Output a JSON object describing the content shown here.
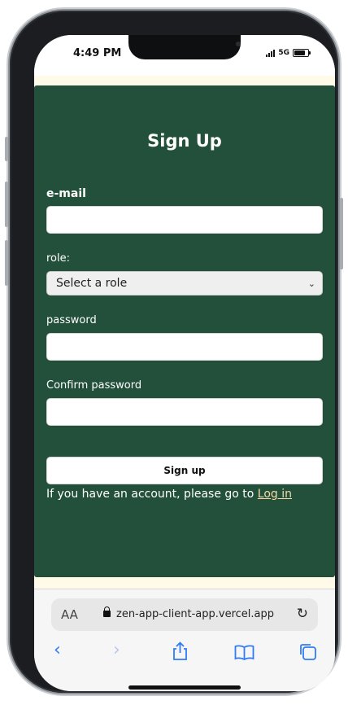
{
  "status_bar": {
    "time": "4:49 PM",
    "network": "5G"
  },
  "form": {
    "title": "Sign Up",
    "email_label": "e-mail",
    "email_value": "",
    "role_label": "role:",
    "role_selected": "Select a role",
    "password_label": "password",
    "confirm_label": "Confirm password",
    "submit_label": "Sign up",
    "login_prompt": "If you have an account, please go to ",
    "login_link": "Log in"
  },
  "browser": {
    "text_size_label": "AA",
    "url": "zen-app-client-app.vercel.app"
  },
  "colors": {
    "card": "#22503a",
    "page_bg": "#fffbe8",
    "link": "#f5d9a6",
    "toolbar_icon": "#2f7cf6"
  },
  "icons": [
    "lock-icon",
    "reload-icon",
    "back-icon",
    "forward-icon",
    "share-icon",
    "bookmarks-icon",
    "tabs-icon"
  ]
}
